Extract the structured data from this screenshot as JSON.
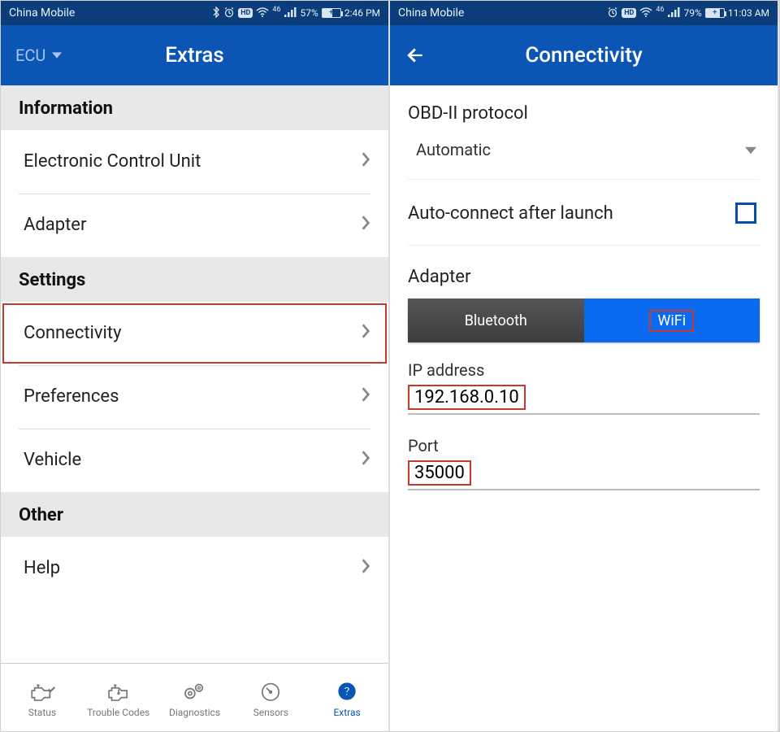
{
  "left": {
    "statusbar": {
      "carrier": "China Mobile",
      "battery_pct": "57%",
      "time": "2:46 PM",
      "signal_label": "46"
    },
    "appbar": {
      "ecu_label": "ECU",
      "title": "Extras"
    },
    "sections": [
      {
        "header": "Information",
        "rows": [
          {
            "label": "Electronic Control Unit"
          },
          {
            "label": "Adapter"
          }
        ]
      },
      {
        "header": "Settings",
        "rows": [
          {
            "label": "Connectivity",
            "highlight": true
          },
          {
            "label": "Preferences"
          },
          {
            "label": "Vehicle"
          }
        ]
      },
      {
        "header": "Other",
        "rows": [
          {
            "label": "Help"
          }
        ]
      }
    ],
    "bottom_nav": {
      "status": "Status",
      "trouble": "Trouble Codes",
      "diag": "Diagnostics",
      "sensors": "Sensors",
      "extras": "Extras"
    }
  },
  "right": {
    "statusbar": {
      "carrier": "China Mobile",
      "battery_pct": "79%",
      "time": "11:03 AM",
      "signal_label": "46"
    },
    "appbar": {
      "title": "Connectivity"
    },
    "protocol_label": "OBD-II protocol",
    "protocol_value": "Automatic",
    "autoconnect_label": "Auto-connect after launch",
    "adapter_label": "Adapter",
    "seg_bluetooth": "Bluetooth",
    "seg_wifi": "WiFi",
    "ip_label": "IP address",
    "ip_value": "192.168.0.10",
    "port_label": "Port",
    "port_value": "35000"
  }
}
